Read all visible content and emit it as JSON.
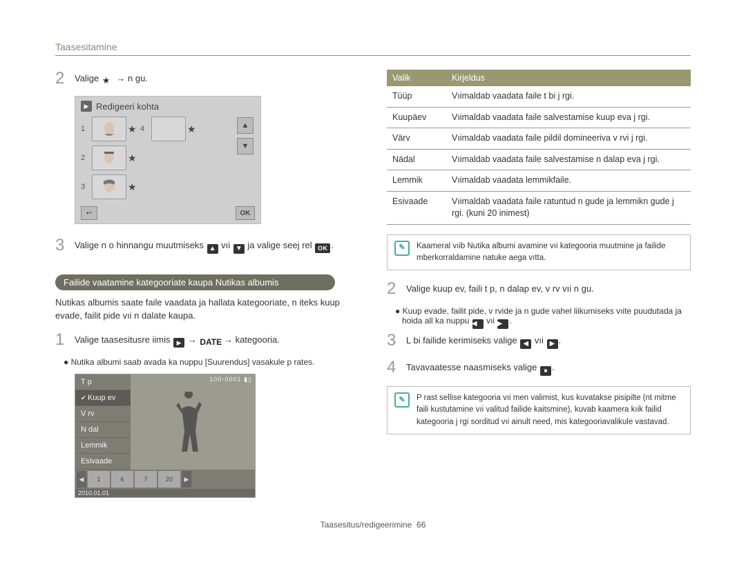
{
  "header": {
    "title": "Taasesitamine"
  },
  "left": {
    "step2": {
      "num": "2",
      "pre": "Valige ",
      "post": " → n gu."
    },
    "fig1": {
      "title": "Redigeeri kohta",
      "rows": [
        "1",
        "2",
        "3",
        "4"
      ]
    },
    "step3": {
      "num": "3",
      "text_a": "Valige n o hinnangu muutmiseks ",
      "text_b": " vıi ",
      "text_c": " ja valige seej rel "
    },
    "section_pill": "Failide vaatamine kategooriate kaupa Nutikas albumis",
    "para1": "Nutikas albumis saate faile vaadata ja hallata kategooriate, n iteks kuup evade, failit  pide vıi n dalate kaupa.",
    "step1b": {
      "num": "1",
      "text_a": "Valige taasesitusre iimis ",
      "text_b": " → ",
      "text_c": " → kategooria."
    },
    "bullet1": "Nutika albumi saab avada ka nuppu [Suurendus] vasakule p  rates.",
    "fig2": {
      "menu": [
        "T  p",
        "Kuup ev",
        "V rv",
        "N dal",
        "Lemmik",
        "Esivaade"
      ],
      "selected_index": 1,
      "topright": "100-0001",
      "thumbs": [
        "1",
        "6",
        "7",
        "20"
      ],
      "date": "2010.01.01"
    }
  },
  "right": {
    "table": {
      "head": [
        "Valik",
        "Kirjeldus"
      ],
      "rows": [
        [
          "Tüüp",
          "Vıimaldab vaadata faile t  bi j rgi."
        ],
        [
          "Kuupäev",
          "Vıimaldab vaadata faile salvestamise kuup eva j rgi."
        ],
        [
          "Värv",
          "Vıimaldab vaadata faile pildil domineeriva v rvi j rgi."
        ],
        [
          "Nädal",
          "Vıimaldab vaadata faile salvestamise n dalap eva j rgi."
        ],
        [
          "Lemmik",
          "Vıimaldab vaadata lemmikfaile."
        ],
        [
          "Esivaade",
          "Vıimaldab vaadata faile  ratuntud n gude ja lemmikn gude j rgi. (kuni 20 inimest)"
        ]
      ]
    },
    "note1": "Kaameral vıib Nutika albumi avamine vıi kategooria muutmine ja failide  mberkorraldamine natuke aega vıtta.",
    "step2r": {
      "num": "2",
      "text": "Valige kuup ev, faili t  p, n dalap ev, v rv vıi n gu."
    },
    "bullet2": "Kuup evade, failit  pide, v rvide ja n gude vahel liikumiseks vıite puudutada ja hoida all ka nuppu ",
    "bullet2_mid": " vıi ",
    "step3r": {
      "num": "3",
      "text_a": "L bi failide kerimiseks valige ",
      "text_b": " vıi "
    },
    "step4r": {
      "num": "4",
      "text_a": "Tavavaatesse naasmiseks valige "
    },
    "note2": "P rast sellise kategooria vıi men   valimist, kus kuvatakse pisipilte (nt mitme faili kustutamine vıi valitud failide kaitsmine), kuvab kaamera kıik failid kategooria j rgi sorditud vıi ainult need, mis kategooriavalikule vastavad."
  },
  "footer": {
    "text": "Taasesitus/redigeerimine",
    "page": "66"
  }
}
